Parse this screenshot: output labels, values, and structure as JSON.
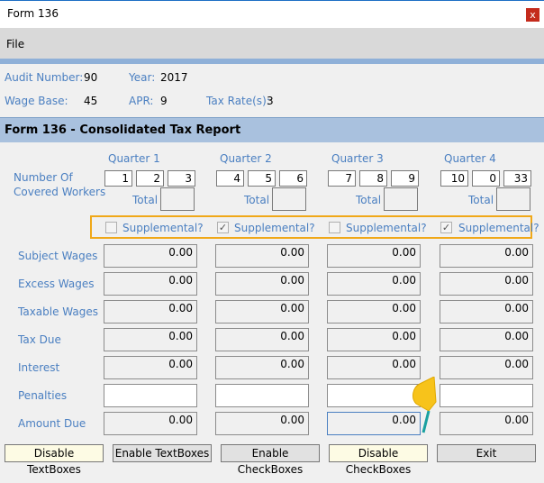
{
  "window": {
    "title": "Form 136",
    "close_glyph": "x"
  },
  "menu": {
    "file": "File"
  },
  "info": {
    "audit_label": "Audit Number:",
    "audit_value": "90",
    "year_label": "Year:",
    "year_value": "2017",
    "wage_label": "Wage Base:",
    "wage_value": "45",
    "apr_label": "APR:",
    "apr_value": "9",
    "tax_label": "Tax Rate(s):",
    "tax_value": "3"
  },
  "report": {
    "title": "Form 136 - Consolidated Tax Report",
    "quarters": [
      "Quarter 1",
      "Quarter 2",
      "Quarter 3",
      "Quarter 4"
    ],
    "covered_label_1": "Number Of",
    "covered_label_2": "Covered Workers",
    "total_label": "Total",
    "workers": [
      [
        "1",
        "2",
        "3"
      ],
      [
        "4",
        "5",
        "6"
      ],
      [
        "7",
        "8",
        "9"
      ],
      [
        "10",
        "0",
        "33"
      ]
    ],
    "supplemental_label": "Supplemental?",
    "supplemental_checked": [
      false,
      true,
      false,
      true
    ],
    "check_glyph": "✓",
    "rows": [
      {
        "label": "Subject Wages",
        "values": [
          "0.00",
          "0.00",
          "0.00",
          "0.00"
        ]
      },
      {
        "label": "Excess Wages",
        "values": [
          "0.00",
          "0.00",
          "0.00",
          "0.00"
        ]
      },
      {
        "label": "Taxable Wages",
        "values": [
          "0.00",
          "0.00",
          "0.00",
          "0.00"
        ]
      },
      {
        "label": "Tax Due",
        "values": [
          "0.00",
          "0.00",
          "0.00",
          "0.00"
        ]
      },
      {
        "label": "Interest",
        "values": [
          "0.00",
          "0.00",
          "0.00",
          "0.00"
        ]
      },
      {
        "label": "Penalties",
        "values": [
          "",
          "",
          "",
          ""
        ]
      },
      {
        "label": "Amount Due",
        "values": [
          "0.00",
          "0.00",
          "0.00",
          "0.00"
        ]
      }
    ]
  },
  "buttons": {
    "disable_textboxes": "Disable TextBoxes",
    "enable_textboxes": "Enable TextBoxes",
    "enable_checkboxes": "Enable CheckBoxes",
    "disable_checkboxes": "Disable CheckBoxes",
    "exit": "Exit"
  },
  "colors": {
    "label": "#4a7fc1",
    "header_band": "#a9c1de",
    "highlight_frame": "#f0a818",
    "cursor": "#f7c31b"
  }
}
